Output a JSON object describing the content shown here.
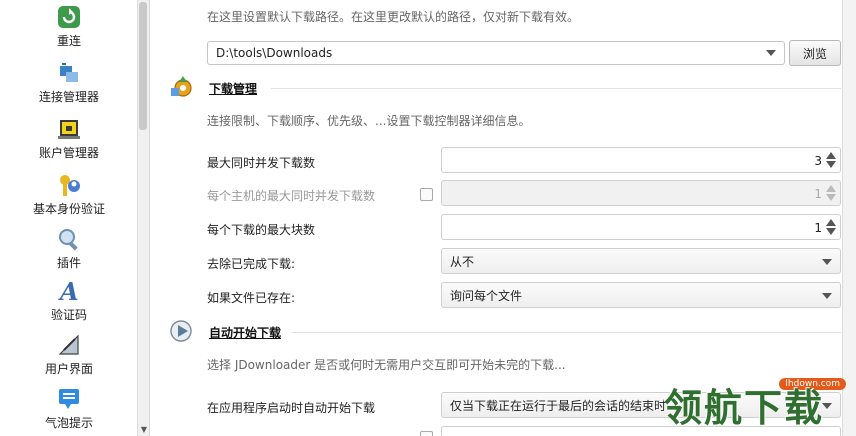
{
  "sidebar": {
    "items": [
      {
        "label": "重连",
        "icon": "reconnect-icon"
      },
      {
        "label": "连接管理器",
        "icon": "connection-manager-icon"
      },
      {
        "label": "账户管理器",
        "icon": "account-manager-icon"
      },
      {
        "label": "基本身份验证",
        "icon": "basic-auth-icon"
      },
      {
        "label": "插件",
        "icon": "plugin-icon"
      },
      {
        "label": "验证码",
        "icon": "captcha-icon"
      },
      {
        "label": "用户界面",
        "icon": "user-interface-icon"
      },
      {
        "label": "气泡提示",
        "icon": "bubble-tip-icon"
      }
    ]
  },
  "download_path": {
    "description": "在这里设置默认下载路径。在这里更改默认的路径，仅对新下载有效。",
    "value": "D:\\tools\\Downloads",
    "browse_label": "浏览"
  },
  "download_management": {
    "title": "下载管理",
    "description": "连接限制、下载顺序、优先级、...设置下载控制器详细信息。",
    "rows": [
      {
        "label": "最大同时并发下载数",
        "value": "3",
        "disabled": false
      },
      {
        "label": "每个主机的最大同时并发下载数",
        "value": "1",
        "disabled": true
      },
      {
        "label": "每个下载的最大块数",
        "value": "1",
        "disabled": false
      }
    ],
    "remove_finished": {
      "label": "去除已完成下载:",
      "value": "从不"
    },
    "file_exists": {
      "label": "如果文件已存在:",
      "value": "询问每个文件"
    }
  },
  "auto_start": {
    "title": "自动开始下载",
    "description": "选择 JDownloader 是否或何时无需用户交互即可开始未完的下载...",
    "row_label": "在应用程序启动时自动开始下载",
    "row_value": "仅当下载正在运行于最后的会话的结束时"
  },
  "watermark": {
    "text": "领航下载",
    "badge": "lhdown.com"
  }
}
